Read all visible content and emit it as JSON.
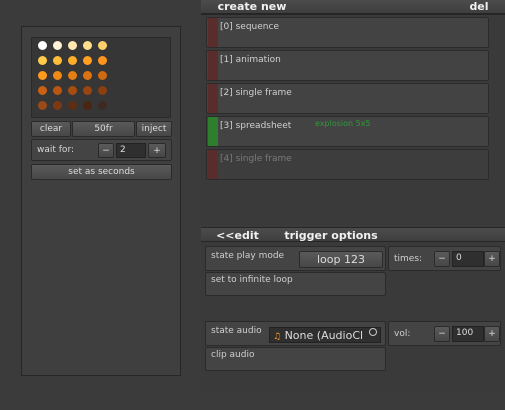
{
  "sprite_panel": {
    "buttons": {
      "clear": "clear",
      "fr": "50fr",
      "inject": "inject"
    },
    "wait_label": "wait for:",
    "wait_minus": "−",
    "wait_value": "2",
    "wait_plus": "+",
    "set_seconds": "set as seconds",
    "swatch_colors": [
      [
        "#ffffff",
        "#fff4d6",
        "#ffe9b0",
        "#ffde8c",
        "#ffd06a"
      ],
      [
        "#ffcb4a",
        "#ffbc38",
        "#ffae2a",
        "#ff9f22",
        "#ff951c"
      ],
      [
        "#ff9a1a",
        "#f08a16",
        "#e67e14",
        "#db7312",
        "#d06910"
      ],
      [
        "#c96012",
        "#b85612",
        "#a84d10",
        "#994510",
        "#8a3f10"
      ],
      [
        "#9a4a18",
        "#7c3a14",
        "#5e2e12",
        "#4a2610",
        "#3e2a22"
      ]
    ]
  },
  "top_bar": {
    "create_new": "create new",
    "del": "del"
  },
  "list_items": [
    {
      "label": "[0] sequence"
    },
    {
      "label": "[1] animation"
    },
    {
      "label": "[2] single frame"
    },
    {
      "label": "[3] spreadsheet",
      "extra": "explosion 5x5"
    },
    {
      "label": "[4] single frame"
    }
  ],
  "bottom_bar": {
    "edit": "<<edit",
    "trigger": "trigger options"
  },
  "state": {
    "play_mode_label": "state play mode",
    "play_mode_value": "loop 123",
    "times_label": "times:",
    "times_minus": "−",
    "times_value": "0",
    "times_plus": "+",
    "infinite_loop": "set to infinite loop",
    "audio_label": "state audio",
    "audio_value": "None (AudioCl",
    "vol_label": "vol:",
    "vol_minus": "−",
    "vol_value": "100",
    "vol_plus": "+",
    "clip_audio": "clip audio"
  }
}
